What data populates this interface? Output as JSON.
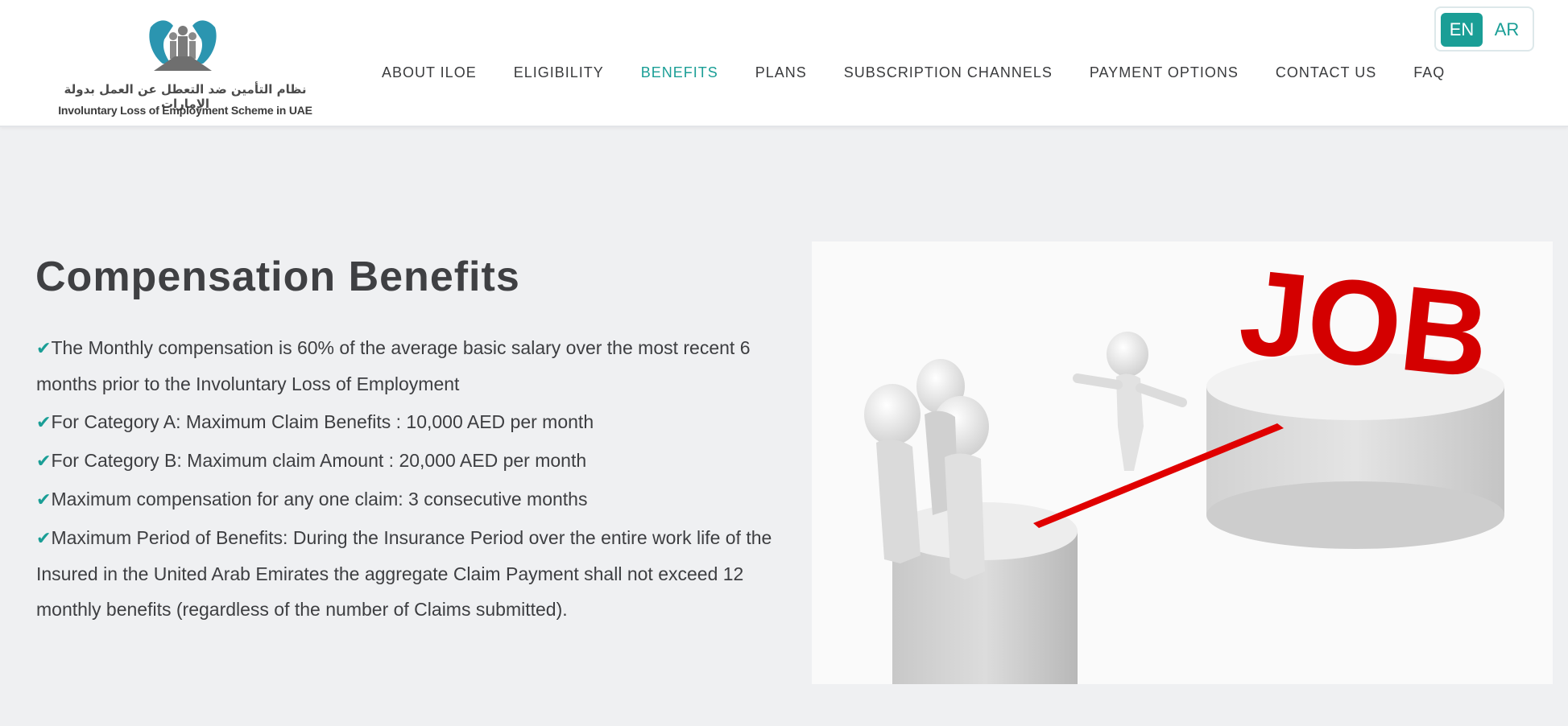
{
  "header": {
    "logo": {
      "arabic_text": "نظام التأمين ضد التعطل عن العمل بدولة الإمارات",
      "english_text": "Involuntary Loss of Employment Scheme in UAE"
    },
    "nav": [
      {
        "label": "ABOUT ILOE",
        "active": false
      },
      {
        "label": "ELIGIBILITY",
        "active": false
      },
      {
        "label": "BENEFITS",
        "active": true
      },
      {
        "label": "PLANS",
        "active": false
      },
      {
        "label": "SUBSCRIPTION CHANNELS",
        "active": false
      },
      {
        "label": "PAYMENT OPTIONS",
        "active": false
      },
      {
        "label": "CONTACT US",
        "active": false
      },
      {
        "label": "FAQ",
        "active": false
      }
    ],
    "language": {
      "en_label": "EN",
      "ar_label": "AR",
      "selected": "EN"
    }
  },
  "main": {
    "title": "Compensation Benefits",
    "check_icon": "✔",
    "benefits": [
      "The Monthly compensation is 60% of the average basic salary over the most recent 6 months prior to the Involuntary Loss of Employment",
      "For Category A: Maximum Claim Benefits : 10,000 AED per month",
      "For Category B: Maximum claim Amount : 20,000 AED per month",
      "Maximum compensation for any one claim: 3 consecutive months",
      "Maximum Period of Benefits: During the Insurance Period over the entire work life of the Insured in the United Arab Emirates the aggregate Claim Payment shall not exceed 12 monthly benefits (regardless of the number of Claims submitted)."
    ],
    "image": {
      "label": "JOB",
      "description": "3D figures crossing a red plank bridge to a podium with JOB text"
    }
  },
  "colors": {
    "accent": "#1a9e96",
    "text": "#3f4043",
    "background": "#eff0f2",
    "logo_blue": "#2b95b0",
    "job_red": "#d40000"
  }
}
